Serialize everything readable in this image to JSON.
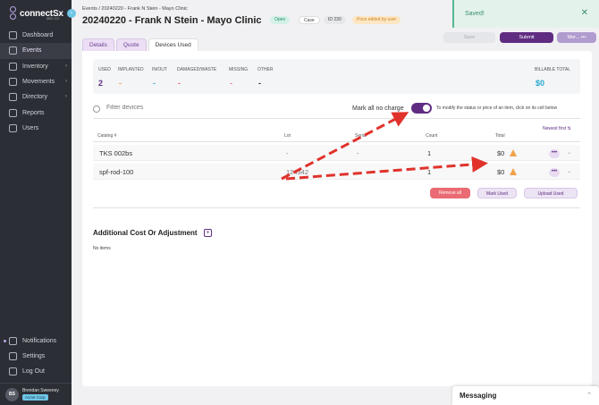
{
  "brand": {
    "name": "connectSx",
    "sub": "MED CO."
  },
  "sidebar": {
    "items": [
      {
        "label": "Dashboard",
        "icon": "dashboard-icon",
        "active": false
      },
      {
        "label": "Events",
        "icon": "calendar-icon",
        "active": true
      },
      {
        "label": "Inventory",
        "icon": "box-icon",
        "active": false,
        "chevron": true
      },
      {
        "label": "Movements",
        "icon": "movements-icon",
        "active": false,
        "chevron": true
      },
      {
        "label": "Directory",
        "icon": "directory-icon",
        "active": false,
        "chevron": true
      },
      {
        "label": "Reports",
        "icon": "reports-icon",
        "active": false
      },
      {
        "label": "Users",
        "icon": "users-icon",
        "active": false
      }
    ],
    "bottom": [
      {
        "label": "Notifications",
        "icon": "bell-icon"
      },
      {
        "label": "Settings",
        "icon": "gear-icon"
      },
      {
        "label": "Log Out",
        "icon": "logout-icon"
      }
    ],
    "user": {
      "initials": "BS",
      "name": "Brendan Sweeney",
      "org": "Acme Corp"
    }
  },
  "header": {
    "breadcrumb": "Events / 20240220 - Frank N Stein - Mayo Clinic",
    "title": "20240220 - Frank N Stein - Mayo Clinic",
    "badges": {
      "status": "Open",
      "type": "Case",
      "id": "ID 230",
      "price": "Price edited by user"
    }
  },
  "toast": {
    "message": "Saved!",
    "close": "✕"
  },
  "toolbar": {
    "save_label": "Save",
    "submit_label": "Submit",
    "more_label": "Mor... •••"
  },
  "tabs": [
    {
      "label": "Details",
      "active": false
    },
    {
      "label": "Quote",
      "active": false
    },
    {
      "label": "Devices Used",
      "active": true
    }
  ],
  "stats": {
    "used": {
      "label": "USED",
      "value": "2"
    },
    "implanted": {
      "label": "IMPLANTED",
      "value": "-"
    },
    "in_out": {
      "label": "IN/OUT",
      "value": "-"
    },
    "damaged": {
      "label": "DAMAGED/WASTE",
      "value": "-"
    },
    "missing": {
      "label": "MISSING",
      "value": "-"
    },
    "other": {
      "label": "OTHER",
      "value": "-"
    },
    "billable": {
      "label": "BILLABLE TOTAL",
      "value": "$0"
    }
  },
  "filter": {
    "placeholder": "Filter devices",
    "no_charge_label": "Mark all no charge",
    "no_charge_on": true,
    "hint": "To modify the status or price of an item, click on its cell below"
  },
  "table": {
    "sort_label": "Newest first ⇅",
    "columns": {
      "catalog": "Catalog #",
      "lot": "Lot",
      "serial": "Serial",
      "count": "Count",
      "total": "Total"
    },
    "rows": [
      {
        "catalog": "TKS 002bs",
        "lot": "-",
        "serial": "-",
        "count": "1",
        "total": "$0"
      },
      {
        "catalog": "spf-rod-100",
        "lot": "124342",
        "serial": "-",
        "count": "1",
        "total": "$0"
      }
    ],
    "row_more": "•••",
    "row_chevron": "⌄"
  },
  "actions": {
    "remove_all": "Remove all",
    "mark_used": "Mark Used",
    "upload_used": "Upload Used"
  },
  "additional": {
    "title": "Additional Cost Or Adjustment",
    "add": "+",
    "empty": "No items"
  },
  "messaging": {
    "title": "Messaging",
    "chevron": "⌃"
  },
  "colors": {
    "accent": "#5f2c82",
    "sidebar": "#2b2e35",
    "success": "#58b690",
    "danger": "#ea6b73",
    "arrow": "#e0322b"
  }
}
